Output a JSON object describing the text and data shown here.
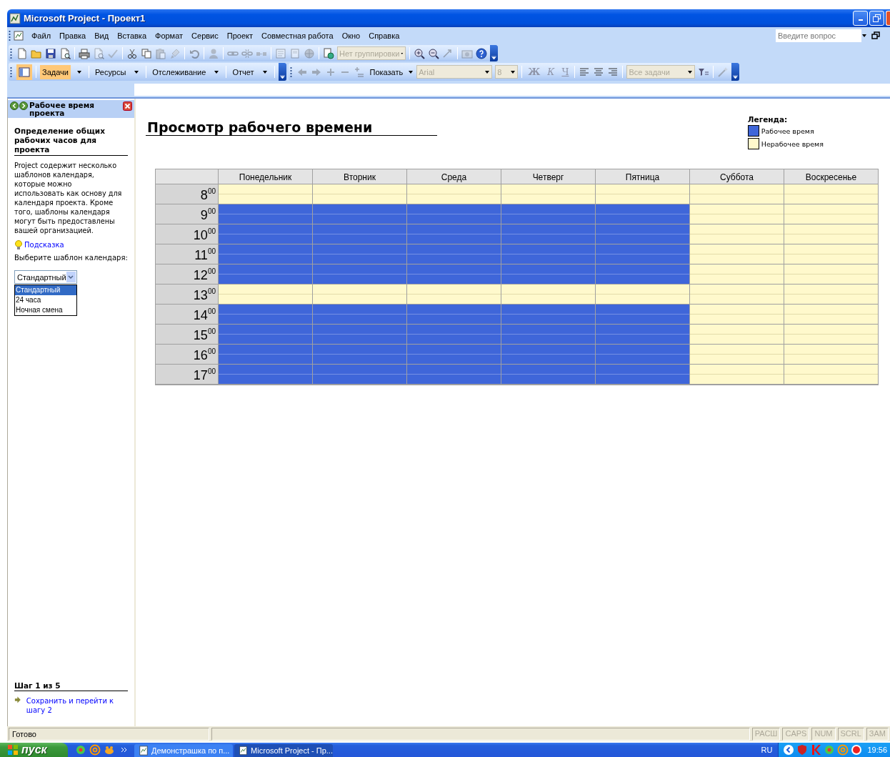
{
  "window": {
    "title": "Microsoft Project - Проект1"
  },
  "menu": [
    "Файл",
    "Правка",
    "Вид",
    "Вставка",
    "Формат",
    "Сервис",
    "Проект",
    "Совместная работа",
    "Окно",
    "Справка"
  ],
  "help_search": {
    "placeholder": "Введите вопрос"
  },
  "standard_toolbar": [
    {
      "kind": "button",
      "disabled": false
    },
    {
      "kind": "button",
      "disabled": false
    },
    {
      "kind": "button",
      "disabled": false
    },
    {
      "kind": "button",
      "disabled": false
    },
    {
      "kind": "separator"
    },
    {
      "kind": "button",
      "disabled": false
    },
    {
      "kind": "button",
      "disabled": true
    },
    {
      "kind": "button",
      "disabled": true
    },
    {
      "kind": "separator"
    },
    {
      "kind": "button",
      "disabled": false
    },
    {
      "kind": "button",
      "disabled": false
    },
    {
      "kind": "button",
      "disabled": true
    },
    {
      "kind": "button",
      "disabled": true
    },
    {
      "kind": "separator"
    },
    {
      "kind": "button",
      "disabled": true
    },
    {
      "kind": "separator"
    },
    {
      "kind": "button",
      "disabled": true
    },
    {
      "kind": "separator"
    },
    {
      "kind": "button",
      "disabled": true
    },
    {
      "kind": "button",
      "disabled": true
    },
    {
      "kind": "button",
      "disabled": true
    },
    {
      "kind": "separator"
    },
    {
      "kind": "button",
      "disabled": true
    },
    {
      "kind": "button",
      "disabled": true
    },
    {
      "kind": "button",
      "disabled": true
    },
    {
      "kind": "separator"
    },
    {
      "kind": "button",
      "disabled": false
    },
    {
      "kind": "combo",
      "value": "Нет группировки",
      "disabled": true
    },
    {
      "kind": "separator"
    },
    {
      "kind": "button",
      "disabled": false
    },
    {
      "kind": "button",
      "disabled": false
    },
    {
      "kind": "button",
      "disabled": true
    },
    {
      "kind": "separator"
    },
    {
      "kind": "button",
      "disabled": true
    },
    {
      "kind": "button",
      "disabled": false
    }
  ],
  "guide_toolbar": [
    {
      "kind": "button",
      "pressed": true
    },
    {
      "kind": "menu",
      "label": "Задачи",
      "pressed": true
    },
    {
      "kind": "menu",
      "label": "Ресурсы",
      "pressed": false
    },
    {
      "kind": "menu",
      "label": "Отслеживание",
      "pressed": false
    },
    {
      "kind": "menu",
      "label": "Отчет",
      "pressed": false
    }
  ],
  "formatting_toolbar": [
    {
      "kind": "button",
      "disabled": true
    },
    {
      "kind": "button",
      "disabled": true
    },
    {
      "kind": "button",
      "disabled": true
    },
    {
      "kind": "button",
      "disabled": true
    },
    {
      "kind": "button",
      "disabled": true
    },
    {
      "kind": "menu",
      "label": "Показать",
      "disabled": false
    },
    {
      "kind": "combo",
      "value": "Arial",
      "disabled": true
    },
    {
      "kind": "combo",
      "value": "8",
      "disabled": true
    },
    {
      "kind": "separator"
    },
    {
      "kind": "text",
      "label": "Ж",
      "disabled": true
    },
    {
      "kind": "text",
      "label": "К",
      "disabled": true
    },
    {
      "kind": "text",
      "label": "Ч",
      "disabled": true
    },
    {
      "kind": "separator"
    },
    {
      "kind": "button",
      "disabled": false
    },
    {
      "kind": "button",
      "disabled": false
    },
    {
      "kind": "button",
      "disabled": false
    },
    {
      "kind": "separator"
    },
    {
      "kind": "combo",
      "value": "Все задачи",
      "disabled": true
    },
    {
      "kind": "button",
      "disabled": false
    },
    {
      "kind": "separator"
    },
    {
      "kind": "button",
      "disabled": true
    }
  ],
  "task_pane": {
    "title": "Рабочее время проекта",
    "heading": "Определение общих рабочих часов для проекта",
    "text": "Project содержит несколько шаблонов календаря, которые можно использовать как основу для календаря проекта. Кроме того, шаблоны календаря могут быть предоставлены вашей организацией.",
    "tip_link": "Подсказка",
    "prompt": "Выберите шаблон календаря:",
    "template": {
      "value": "Стандартный",
      "options": [
        {
          "label": "Стандартный",
          "selected": true
        },
        {
          "label": "24 часа",
          "selected": false
        },
        {
          "label": "Ночная смена",
          "selected": false
        }
      ]
    },
    "step": "Шаг 1 из 5",
    "next_link": "Сохранить и перейти к шагу 2"
  },
  "view": {
    "title": "Просмотр рабочего времени",
    "legend": {
      "title": "Легенда:",
      "items": [
        {
          "label": "Рабочее время",
          "kind": "work"
        },
        {
          "label": "Нерабочее время",
          "kind": "nonwork"
        }
      ]
    },
    "days": [
      "Понедельник",
      "Вторник",
      "Среда",
      "Четверг",
      "Пятница",
      "Суббота",
      "Воскресенье"
    ],
    "rows": [
      {
        "hour": "8$^{00}$",
        "work": [
          false,
          false,
          false,
          false,
          false,
          false,
          false
        ]
      },
      {
        "hour": "9$^{00}$",
        "work": [
          true,
          true,
          true,
          true,
          true,
          false,
          false
        ]
      },
      {
        "hour": "10$^{00}$",
        "work": [
          true,
          true,
          true,
          true,
          true,
          false,
          false
        ]
      },
      {
        "hour": "11$^{00}$",
        "work": [
          true,
          true,
          true,
          true,
          true,
          false,
          false
        ]
      },
      {
        "hour": "12$^{00}$",
        "work": [
          true,
          true,
          true,
          true,
          true,
          false,
          false
        ]
      },
      {
        "hour": "13$^{00}$",
        "work": [
          false,
          false,
          false,
          false,
          false,
          false,
          false
        ]
      },
      {
        "hour": "14$^{00}$",
        "work": [
          true,
          true,
          true,
          true,
          true,
          false,
          false
        ]
      },
      {
        "hour": "15$^{00}$",
        "work": [
          true,
          true,
          true,
          true,
          true,
          false,
          false
        ]
      },
      {
        "hour": "16$^{00}$",
        "work": [
          true,
          true,
          true,
          true,
          true,
          false,
          false
        ]
      },
      {
        "hour": "17$^{00}$",
        "work": [
          true,
          true,
          true,
          true,
          true,
          false,
          false
        ]
      }
    ]
  },
  "status_bar": {
    "text": "Готово",
    "indicators": [
      {
        "label": "РАСШ",
        "on": false
      },
      {
        "label": "CAPS",
        "on": false
      },
      {
        "label": "NUM",
        "on": false
      },
      {
        "label": "SCRL",
        "on": false
      },
      {
        "label": "ЗАМ",
        "on": false
      }
    ]
  },
  "taskbar": {
    "start": "пуск",
    "tasks": [
      {
        "label": "Демонстрашка по п...",
        "selected": false
      },
      {
        "label": "Microsoft Project - Пр...",
        "selected": true
      }
    ],
    "language": "RU",
    "clock": "19:56"
  }
}
